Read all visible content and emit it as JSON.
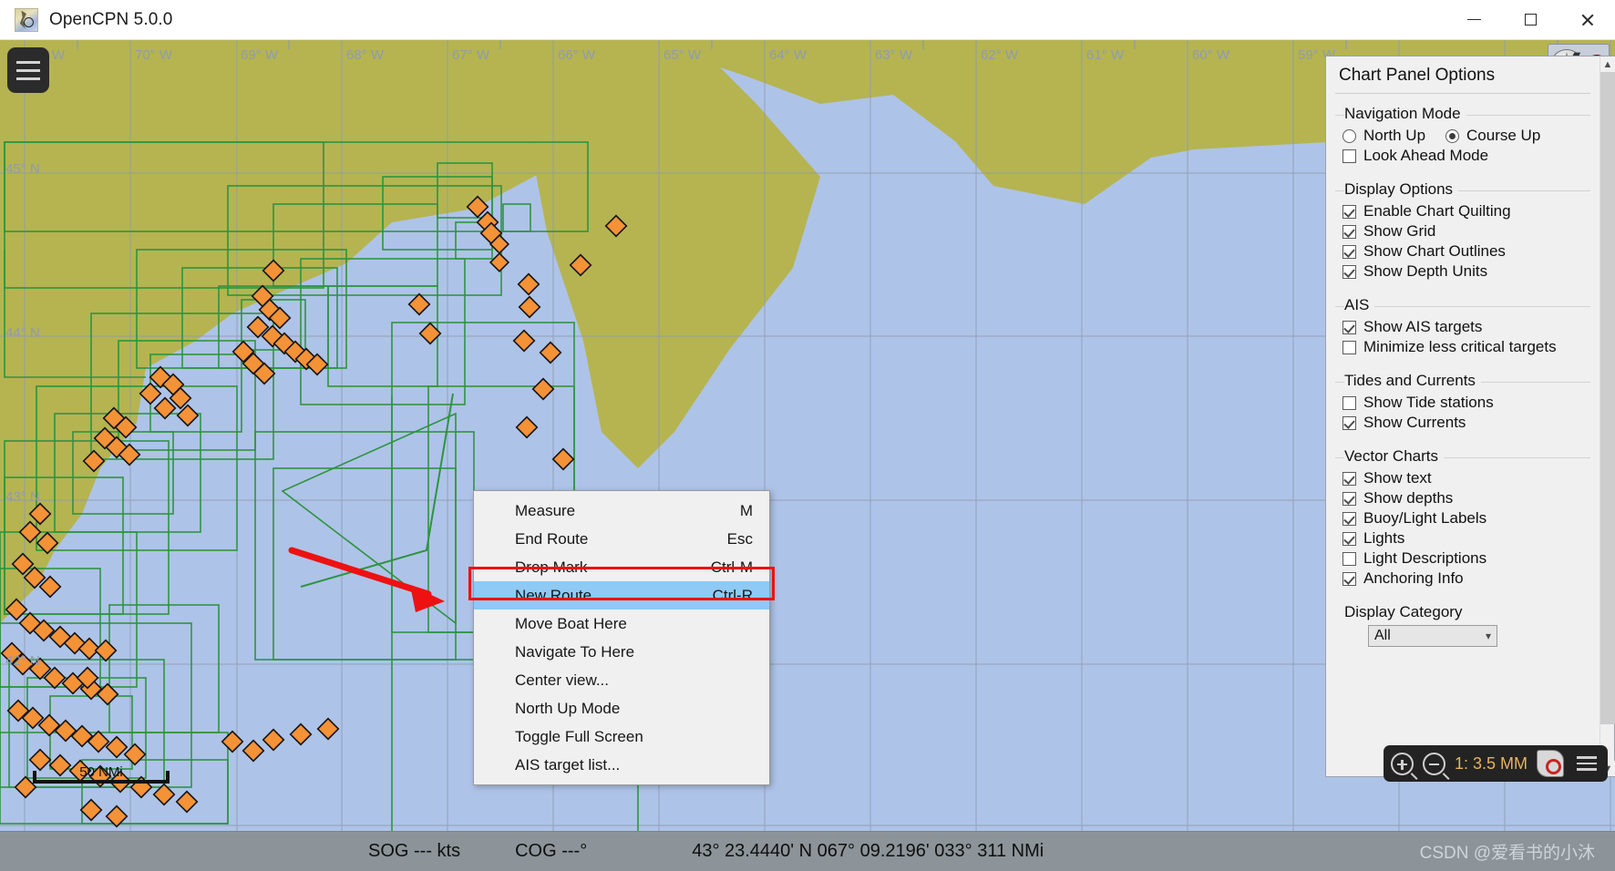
{
  "window": {
    "title": "OpenCPN 5.0.0",
    "app_icon": "opencpn-logo-icon",
    "minimize_label": "Minimize",
    "maximize_label": "Maximize",
    "close_label": "Close"
  },
  "chart": {
    "menu_button_icon": "hamburger-menu-icon",
    "compass_icon": "compass-rose-icon",
    "gps_status_icon": "gps-status-icon",
    "satellite_icon": "satellite-icon",
    "scale_label": "50 NMi",
    "lon_labels": [
      "71° W",
      "70° W",
      "69° W",
      "68° W",
      "67° W",
      "66° W",
      "65° W",
      "64° W",
      "63° W",
      "62° W",
      "61° W",
      "60° W",
      "59° W"
    ],
    "lat_labels": [
      "45° N",
      "44° N",
      "43° N",
      "42° N"
    ],
    "colors": {
      "water": "#aec3e8",
      "land": "#b5b451",
      "chart_outline": "#2e9440",
      "ais_target": "#f49237",
      "graticule": "#8f9bb0"
    }
  },
  "context_menu": {
    "items": [
      {
        "label": "Measure",
        "accel": "M"
      },
      {
        "label": "End Route",
        "accel": "Esc"
      },
      {
        "label": "Drop Mark",
        "accel": "Ctrl-M"
      },
      {
        "label": "New Route...",
        "accel": "Ctrl-R"
      },
      {
        "label": "Move Boat Here",
        "accel": ""
      },
      {
        "label": "Navigate To Here",
        "accel": ""
      },
      {
        "label": "Center view...",
        "accel": ""
      },
      {
        "label": "North Up Mode",
        "accel": ""
      },
      {
        "label": "Toggle Full Screen",
        "accel": ""
      },
      {
        "label": "AIS target list...",
        "accel": ""
      }
    ],
    "selected_index": 3,
    "highlight_color": "#8ecaf3",
    "annotation_color": "#ee1111"
  },
  "options_panel": {
    "title": "Chart Panel Options",
    "scroll_up_icon": "chevron-up-icon",
    "scroll_down_icon": "chevron-down-icon",
    "groups": [
      {
        "legend": "Navigation Mode",
        "radios": [
          {
            "label": "North Up",
            "checked": false
          },
          {
            "label": "Course Up",
            "checked": true
          }
        ],
        "checkboxes": [
          {
            "label": "Look Ahead Mode",
            "checked": false
          }
        ]
      },
      {
        "legend": "Display Options",
        "radios": [],
        "checkboxes": [
          {
            "label": "Enable Chart Quilting",
            "checked": true
          },
          {
            "label": "Show Grid",
            "checked": true
          },
          {
            "label": "Show Chart Outlines",
            "checked": true
          },
          {
            "label": "Show Depth Units",
            "checked": true
          }
        ]
      },
      {
        "legend": "AIS",
        "radios": [],
        "checkboxes": [
          {
            "label": "Show AIS targets",
            "checked": true
          },
          {
            "label": "Minimize less critical targets",
            "checked": false
          }
        ]
      },
      {
        "legend": "Tides and Currents",
        "radios": [],
        "checkboxes": [
          {
            "label": "Show Tide stations",
            "checked": false
          },
          {
            "label": "Show Currents",
            "checked": true
          }
        ]
      },
      {
        "legend": "Vector Charts",
        "radios": [],
        "checkboxes": [
          {
            "label": "Show text",
            "checked": true
          },
          {
            "label": "Show depths",
            "checked": true
          },
          {
            "label": "Buoy/Light Labels",
            "checked": true
          },
          {
            "label": "Lights",
            "checked": true
          },
          {
            "label": "Light Descriptions",
            "checked": false
          },
          {
            "label": "Anchoring Info",
            "checked": true
          }
        ]
      }
    ],
    "display_category": {
      "label": "Display Category",
      "value": "All",
      "arrow_icon": "chevron-down-icon"
    }
  },
  "zoom_toolbar": {
    "zoom_in_icon": "zoom-in-icon",
    "zoom_out_icon": "zoom-out-icon",
    "scale_text": "1: 3.5 MM",
    "follow_boat_icon": "follow-boat-icon",
    "menu_icon": "toolbar-menu-icon",
    "scale_color": "#e8b35c"
  },
  "status_bar": {
    "sog": "SOG --- kts",
    "cog": "COG ---°",
    "position": "43° 23.4440' N   067° 09.2196'  033°  311 NMi",
    "watermark": "CSDN @爱看书的小沐"
  }
}
